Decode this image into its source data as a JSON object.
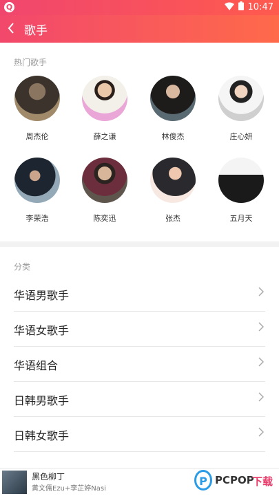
{
  "status": {
    "time": "10:47",
    "app_icon": "Q"
  },
  "header": {
    "title": "歌手"
  },
  "hot": {
    "label": "热门歌手",
    "singers": [
      {
        "name": "周杰伦"
      },
      {
        "name": "薛之谦"
      },
      {
        "name": "林俊杰"
      },
      {
        "name": "庄心妍"
      },
      {
        "name": "李荣浩"
      },
      {
        "name": "陈奕迅"
      },
      {
        "name": "张杰"
      },
      {
        "name": "五月天"
      }
    ]
  },
  "categories": {
    "label": "分类",
    "items": [
      "华语男歌手",
      "华语女歌手",
      "华语组合",
      "日韩男歌手",
      "日韩女歌手"
    ]
  },
  "player": {
    "song": "黑色柳丁",
    "artist": "黄文儒Ezu+李芷婷Nasi"
  },
  "watermark": {
    "p": "P",
    "text": "PCPOP",
    "suffix": "下载"
  }
}
